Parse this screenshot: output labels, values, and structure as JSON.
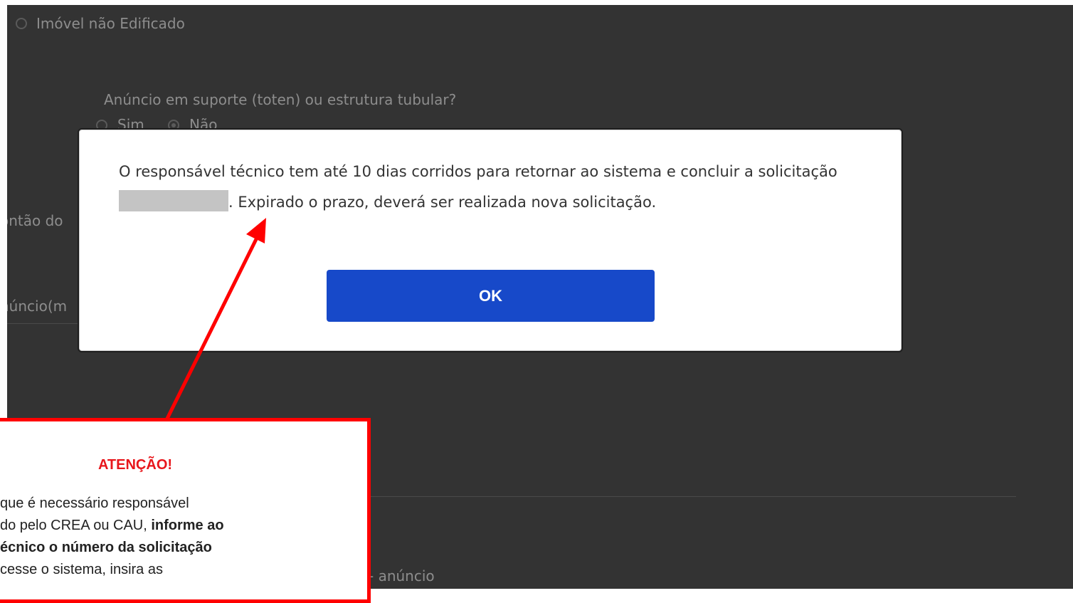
{
  "background": {
    "property_type_option": "Imóvel não Edificado",
    "support_question": "Anúncio em suporte (toten) ou estrutura tubular?",
    "option_yes": "Sim",
    "option_no": "Não",
    "field_left_1": "ontão do",
    "field_left_2": "núncio(m",
    "bottom_label": "- anúncio"
  },
  "modal": {
    "message_part1": "O responsável técnico tem até 10 dias corridos para retornar ao sistema e concluir a solicitação",
    "message_part2": ". Expirado o prazo, deverá ser realizada nova solicitação.",
    "ok_label": "OK"
  },
  "callout": {
    "title": "ATENÇÃO!",
    "line1": "que é necessário responsável",
    "line2_plain": "do pelo CREA ou CAU, ",
    "line2_bold": "informe ao",
    "line3_bold": "écnico o número da solicitação",
    "line4": "cesse o sistema, insira as"
  },
  "colors": {
    "accent_button": "#1749c9",
    "callout_border": "#ff0000",
    "callout_title": "#e8161b",
    "backdrop": "#333333"
  }
}
